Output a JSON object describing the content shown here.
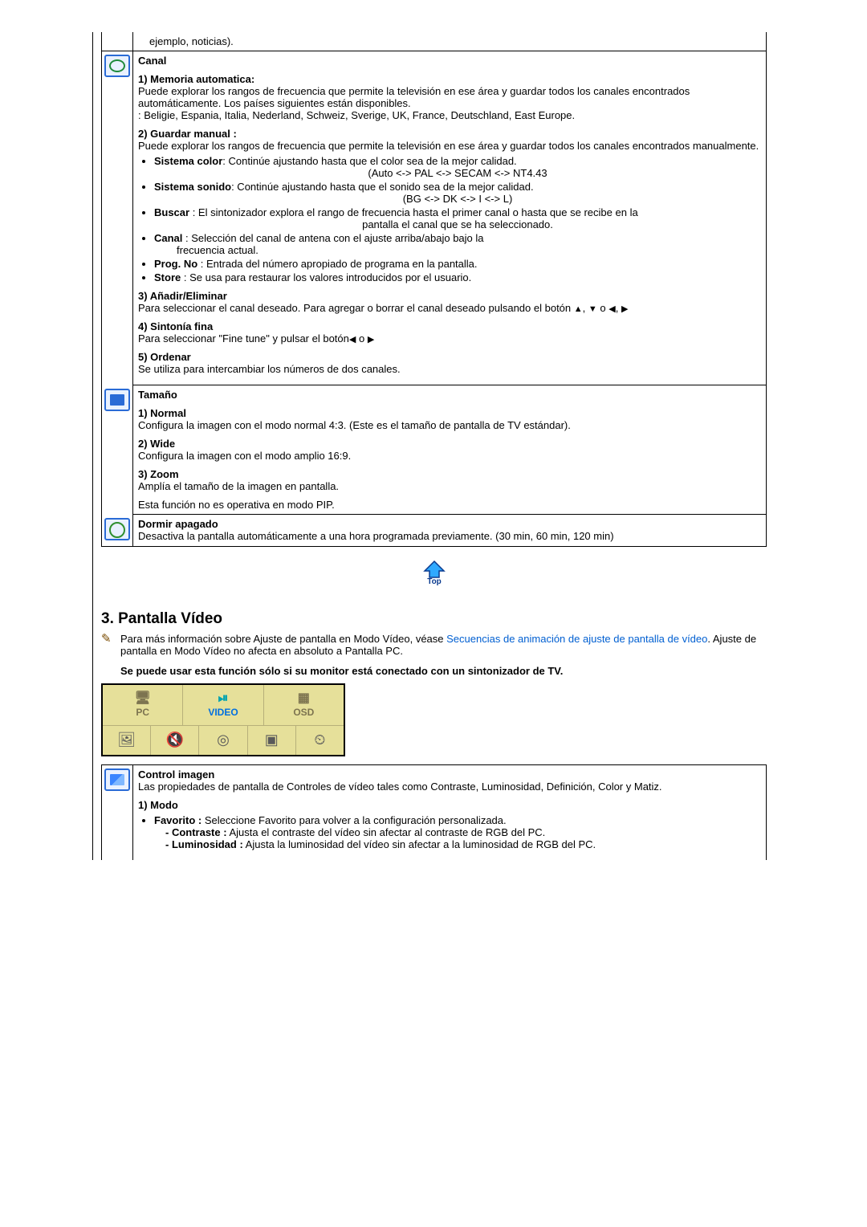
{
  "fragment_above": "ejemplo, noticias).",
  "canal": {
    "title": "Canal",
    "s1": {
      "heading": "1) Memoria automatica",
      "p1": "Puede explorar los rangos de frecuencia que permite la televisión en ese área y guardar todos los canales encontrados automáticamente. Los países siguientes están disponibles.",
      "p2": ": Beligie, Espania, Italia, Nederland, Schweiz, Sverige, UK, France, Deutschland, East Europe."
    },
    "s2": {
      "heading": "2) Guardar manual :",
      "p": "Puede explorar los rangos de frecuencia que permite la televisión en ese área y guardar todos los canales encontrados manualmente.",
      "b1_label": "Sistema color",
      "b1_text": ": Continúe ajustando hasta que el color sea de la mejor calidad.",
      "b1_sub": "(Auto <-> PAL <-> SECAM <-> NT4.43",
      "b2_label": "Sistema sonido",
      "b2_text": ": Continúe ajustando hasta que el sonido sea de la mejor calidad.",
      "b2_sub": "(BG <-> DK <-> I <-> L)",
      "b3_label": "Buscar",
      "b3_text": " : El sintonizador explora el rango de frecuencia hasta el primer canal o hasta que se recibe en la",
      "b3_sub": "pantalla el canal que se ha seleccionado.",
      "b4_label": "Canal",
      "b4_text": " : Selección del canal de antena con el ajuste arriba/abajo bajo la",
      "b4_sub": "frecuencia actual.",
      "b5_label": "Prog. No",
      "b5_text": " : Entrada del número apropiado de programa en la pantalla.",
      "b6_label": "Store",
      "b6_text": " : Se usa para restaurar los valores introducidos por el usuario."
    },
    "s3": {
      "heading": "3) Añadir/Eliminar",
      "p_a": "Para seleccionar el canal deseado. Para agregar o borrar el canal deseado pulsando el botón ",
      "p_b": " o "
    },
    "s4": {
      "heading": "4) Sintonía fina",
      "p_a": "Para seleccionar \"Fine tune\" y pulsar el botón",
      "p_b": " o "
    },
    "s5": {
      "heading": "5) Ordenar",
      "p": "Se utiliza para intercambiar los números de dos canales."
    }
  },
  "tamano": {
    "title": "Tamaño",
    "s1_h": "1) Normal",
    "s1_p": "Configura la imagen con el modo normal 4:3. (Este es el tamaño de pantalla de TV estándar).",
    "s2_h": "2) Wide",
    "s2_p": "Configura la imagen con el modo amplio 16:9.",
    "s3_h": "3) Zoom",
    "s3_p": "Amplía el tamaño de la imagen en pantalla.",
    "note": "Esta función no es operativa en modo PIP."
  },
  "dormir": {
    "title": "Dormir apagado",
    "p": "Desactiva la pantalla automáticamente a una hora programada previamente. (30 min, 60 min, 120 min)"
  },
  "video": {
    "heading": "3. Pantalla Vídeo",
    "info_a": "Para más información sobre Ajuste de pantalla en Modo Vídeo, véase ",
    "info_link": "Secuencias de animación de ajuste de pantalla de vídeo",
    "info_b": ". Ajuste de pantalla en Modo Vídeo no afecta en absoluto a Pantalla PC.",
    "info_bold": "Se puede usar esta función sólo si su monitor está conectado con un sintonizador de TV.",
    "tabs": {
      "pc": "PC",
      "video": "VIDEO",
      "osd": "OSD"
    }
  },
  "control": {
    "title": "Control imagen",
    "p": "Las propiedades de pantalla de Controles de vídeo tales como Contraste, Luminosidad, Definición, Color y Matiz.",
    "s1_h": "1) Modo",
    "b_fav_label": "Favorito :",
    "b_fav_text": " Seleccione Favorito para volver a la configuración personalizada.",
    "sub_con_label": "- Contraste :",
    "sub_con_text": " Ajusta el contraste del vídeo sin afectar al contraste de RGB del PC.",
    "sub_lum_label": "- Luminosidad :",
    "sub_lum_text": " Ajusta la luminosidad del vídeo sin afectar a la luminosidad de RGB del PC."
  },
  "top_label": "Top"
}
